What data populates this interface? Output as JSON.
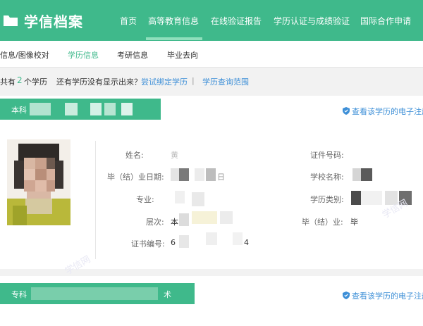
{
  "brand": {
    "name": "学信档案"
  },
  "topnav": {
    "items": [
      {
        "label": "首页"
      },
      {
        "label": "高等教育信息"
      },
      {
        "label": "在线验证报告"
      },
      {
        "label": "学历认证与成绩验证"
      },
      {
        "label": "国际合作申请"
      }
    ],
    "active_index": 1
  },
  "subnav": {
    "items": [
      {
        "label": "信息/图像校对"
      },
      {
        "label": "学历信息"
      },
      {
        "label": "考研信息"
      },
      {
        "label": "毕业去向"
      }
    ],
    "active_index": 1
  },
  "infobar": {
    "prefix": "共有",
    "count": "2",
    "suffix": "个学历",
    "question": "还有学历没有显示出来？",
    "bind_link": "尝试绑定学历",
    "sep": "|",
    "range_link": "学历查询范围"
  },
  "record1": {
    "head_label": "本科",
    "ereg_link": "查看该学历的电子注册",
    "fields": {
      "name_label": "姓名:",
      "name_value": "黄",
      "grad_date_label": "毕（结）业日期:",
      "grad_date_value": "日",
      "major_label": "专业:",
      "level_label": "层次:",
      "level_value": "本",
      "cert_no_label": "证书编号:",
      "cert_no_prefix": "6",
      "cert_no_suffix": "4",
      "id_no_label": "证件号码:",
      "school_label": "学校名称:",
      "edu_type_label": "学历类别:",
      "grad_status_label": "毕（结）业:",
      "grad_status_value": "毕"
    }
  },
  "record2": {
    "head_label": "专科",
    "head_tail": "术",
    "ereg_link": "查看该学历的电子注册"
  },
  "watermark": "学信网",
  "colors": {
    "brand_green": "#3fb98b",
    "link_blue": "#3d8fd7"
  }
}
